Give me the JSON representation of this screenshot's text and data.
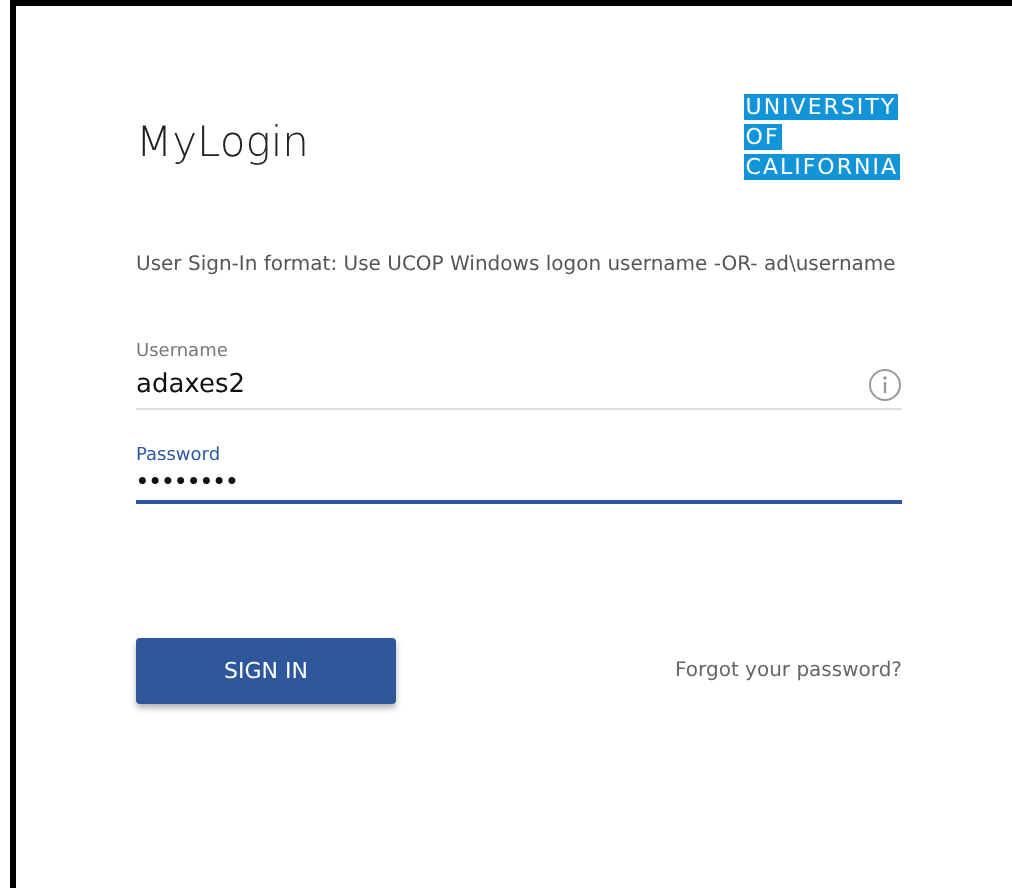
{
  "title": "MyLogin",
  "logo": [
    "UNIVERSITY",
    "OF",
    "CALIFORNIA"
  ],
  "hint": "User Sign-In format: Use UCOP Windows logon username -OR- ad\\username",
  "fields": [
    {
      "label": "Username",
      "value": "adaxes2",
      "focused": false,
      "info": true
    },
    {
      "label": "Password",
      "value": "••••••••",
      "focused": true,
      "info": false
    }
  ],
  "sign_in_button": "SIGN IN",
  "forgot_link": "Forgot your password?"
}
